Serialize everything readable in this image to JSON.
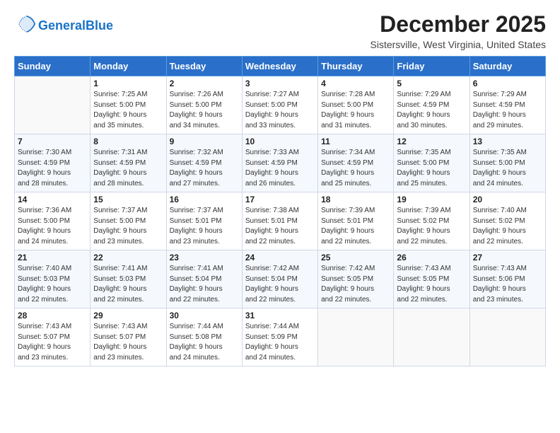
{
  "header": {
    "logo_line1": "General",
    "logo_line2": "Blue",
    "title": "December 2025",
    "subtitle": "Sistersville, West Virginia, United States"
  },
  "days_of_week": [
    "Sunday",
    "Monday",
    "Tuesday",
    "Wednesday",
    "Thursday",
    "Friday",
    "Saturday"
  ],
  "weeks": [
    [
      {
        "day": "",
        "info": ""
      },
      {
        "day": "1",
        "info": "Sunrise: 7:25 AM\nSunset: 5:00 PM\nDaylight: 9 hours\nand 35 minutes."
      },
      {
        "day": "2",
        "info": "Sunrise: 7:26 AM\nSunset: 5:00 PM\nDaylight: 9 hours\nand 34 minutes."
      },
      {
        "day": "3",
        "info": "Sunrise: 7:27 AM\nSunset: 5:00 PM\nDaylight: 9 hours\nand 33 minutes."
      },
      {
        "day": "4",
        "info": "Sunrise: 7:28 AM\nSunset: 5:00 PM\nDaylight: 9 hours\nand 31 minutes."
      },
      {
        "day": "5",
        "info": "Sunrise: 7:29 AM\nSunset: 4:59 PM\nDaylight: 9 hours\nand 30 minutes."
      },
      {
        "day": "6",
        "info": "Sunrise: 7:29 AM\nSunset: 4:59 PM\nDaylight: 9 hours\nand 29 minutes."
      }
    ],
    [
      {
        "day": "7",
        "info": "Sunrise: 7:30 AM\nSunset: 4:59 PM\nDaylight: 9 hours\nand 28 minutes."
      },
      {
        "day": "8",
        "info": "Sunrise: 7:31 AM\nSunset: 4:59 PM\nDaylight: 9 hours\nand 28 minutes."
      },
      {
        "day": "9",
        "info": "Sunrise: 7:32 AM\nSunset: 4:59 PM\nDaylight: 9 hours\nand 27 minutes."
      },
      {
        "day": "10",
        "info": "Sunrise: 7:33 AM\nSunset: 4:59 PM\nDaylight: 9 hours\nand 26 minutes."
      },
      {
        "day": "11",
        "info": "Sunrise: 7:34 AM\nSunset: 4:59 PM\nDaylight: 9 hours\nand 25 minutes."
      },
      {
        "day": "12",
        "info": "Sunrise: 7:35 AM\nSunset: 5:00 PM\nDaylight: 9 hours\nand 25 minutes."
      },
      {
        "day": "13",
        "info": "Sunrise: 7:35 AM\nSunset: 5:00 PM\nDaylight: 9 hours\nand 24 minutes."
      }
    ],
    [
      {
        "day": "14",
        "info": "Sunrise: 7:36 AM\nSunset: 5:00 PM\nDaylight: 9 hours\nand 24 minutes."
      },
      {
        "day": "15",
        "info": "Sunrise: 7:37 AM\nSunset: 5:00 PM\nDaylight: 9 hours\nand 23 minutes."
      },
      {
        "day": "16",
        "info": "Sunrise: 7:37 AM\nSunset: 5:01 PM\nDaylight: 9 hours\nand 23 minutes."
      },
      {
        "day": "17",
        "info": "Sunrise: 7:38 AM\nSunset: 5:01 PM\nDaylight: 9 hours\nand 22 minutes."
      },
      {
        "day": "18",
        "info": "Sunrise: 7:39 AM\nSunset: 5:01 PM\nDaylight: 9 hours\nand 22 minutes."
      },
      {
        "day": "19",
        "info": "Sunrise: 7:39 AM\nSunset: 5:02 PM\nDaylight: 9 hours\nand 22 minutes."
      },
      {
        "day": "20",
        "info": "Sunrise: 7:40 AM\nSunset: 5:02 PM\nDaylight: 9 hours\nand 22 minutes."
      }
    ],
    [
      {
        "day": "21",
        "info": "Sunrise: 7:40 AM\nSunset: 5:03 PM\nDaylight: 9 hours\nand 22 minutes."
      },
      {
        "day": "22",
        "info": "Sunrise: 7:41 AM\nSunset: 5:03 PM\nDaylight: 9 hours\nand 22 minutes."
      },
      {
        "day": "23",
        "info": "Sunrise: 7:41 AM\nSunset: 5:04 PM\nDaylight: 9 hours\nand 22 minutes."
      },
      {
        "day": "24",
        "info": "Sunrise: 7:42 AM\nSunset: 5:04 PM\nDaylight: 9 hours\nand 22 minutes."
      },
      {
        "day": "25",
        "info": "Sunrise: 7:42 AM\nSunset: 5:05 PM\nDaylight: 9 hours\nand 22 minutes."
      },
      {
        "day": "26",
        "info": "Sunrise: 7:43 AM\nSunset: 5:05 PM\nDaylight: 9 hours\nand 22 minutes."
      },
      {
        "day": "27",
        "info": "Sunrise: 7:43 AM\nSunset: 5:06 PM\nDaylight: 9 hours\nand 23 minutes."
      }
    ],
    [
      {
        "day": "28",
        "info": "Sunrise: 7:43 AM\nSunset: 5:07 PM\nDaylight: 9 hours\nand 23 minutes."
      },
      {
        "day": "29",
        "info": "Sunrise: 7:43 AM\nSunset: 5:07 PM\nDaylight: 9 hours\nand 23 minutes."
      },
      {
        "day": "30",
        "info": "Sunrise: 7:44 AM\nSunset: 5:08 PM\nDaylight: 9 hours\nand 24 minutes."
      },
      {
        "day": "31",
        "info": "Sunrise: 7:44 AM\nSunset: 5:09 PM\nDaylight: 9 hours\nand 24 minutes."
      },
      {
        "day": "",
        "info": ""
      },
      {
        "day": "",
        "info": ""
      },
      {
        "day": "",
        "info": ""
      }
    ]
  ]
}
